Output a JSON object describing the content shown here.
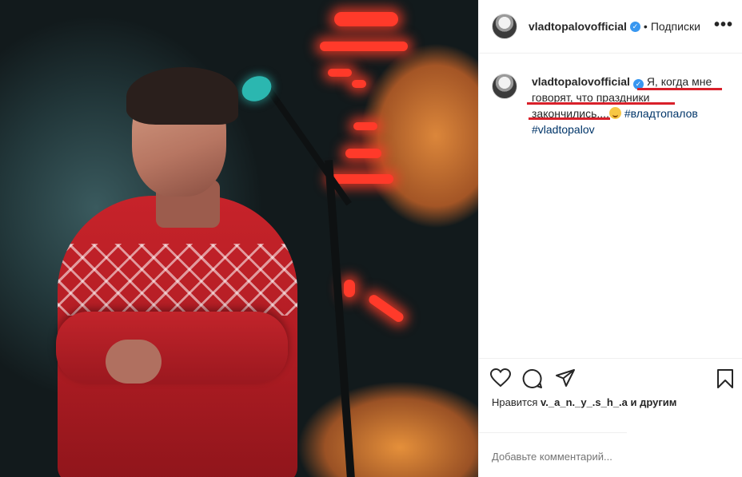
{
  "header": {
    "username": "vladtopalovofficial",
    "verified": true,
    "separator": "•",
    "follow_status": "Подписки",
    "more_icon": "more-horizontal-icon"
  },
  "caption": {
    "username": "vladtopalovofficial",
    "text_line1": "Я, когда мне говорят, что праздники закончились....",
    "emoji": "smirk",
    "hashtag1": "#владтопалов",
    "hashtag2": "#vladtopalov"
  },
  "actions": {
    "like_icon": "heart-icon",
    "comment_icon": "comment-icon",
    "share_icon": "paper-plane-icon",
    "save_icon": "bookmark-icon"
  },
  "likes": {
    "prefix": "Нравится",
    "user": "v._a_n._y_.s_h_.a",
    "suffix": "и другим"
  },
  "comment": {
    "placeholder": "Добавьте комментарий..."
  },
  "colors": {
    "hashtag": "#003569",
    "verified": "#3897f0",
    "annotation_underline": "#d9202a"
  }
}
